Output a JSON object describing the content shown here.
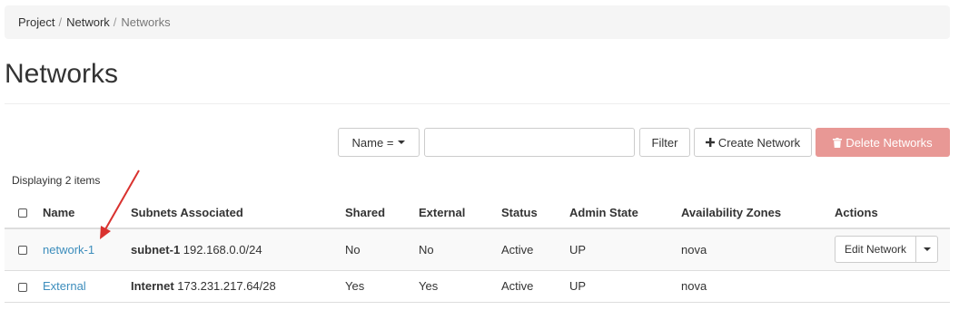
{
  "breadcrumb": {
    "items": [
      "Project",
      "Network",
      "Networks"
    ],
    "separator": "/"
  },
  "page": {
    "title": "Networks"
  },
  "toolbar": {
    "filter_select_label": "Name =",
    "filter_input_value": "",
    "filter_button": "Filter",
    "create_button": "Create Network",
    "delete_button": "Delete Networks"
  },
  "table": {
    "count_text": "Displaying 2 items",
    "columns": [
      "Name",
      "Subnets Associated",
      "Shared",
      "External",
      "Status",
      "Admin State",
      "Availability Zones",
      "Actions"
    ],
    "rows": [
      {
        "name": "network-1",
        "subnet_name": "subnet-1",
        "subnet_cidr": "192.168.0.0/24",
        "shared": "No",
        "external": "No",
        "status": "Active",
        "admin_state": "UP",
        "zones": "nova",
        "action": "Edit Network"
      },
      {
        "name": "External",
        "subnet_name": "Internet",
        "subnet_cidr": "173.231.217.64/28",
        "shared": "Yes",
        "external": "Yes",
        "status": "Active",
        "admin_state": "UP",
        "zones": "nova",
        "action": ""
      }
    ]
  },
  "colors": {
    "link": "#3c8dbc",
    "danger_button": "#e89895",
    "annotation_arrow": "#d9322f"
  },
  "icons": {
    "create": "plus-icon",
    "delete": "trash-icon",
    "select_caret": "caret-down-icon",
    "action_caret": "caret-down-icon"
  }
}
